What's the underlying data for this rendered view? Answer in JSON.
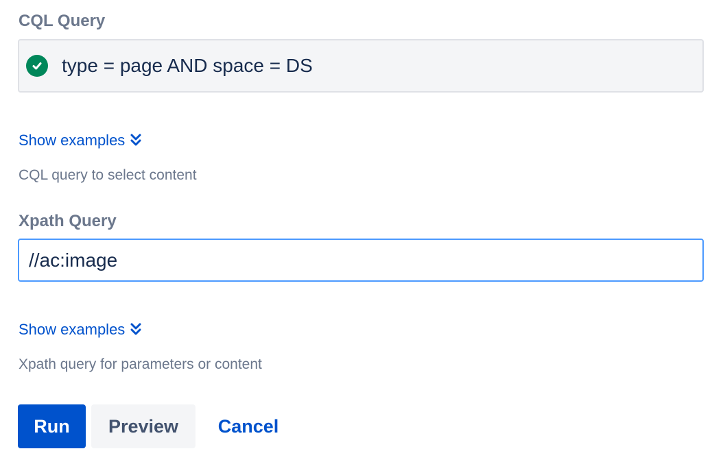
{
  "cql": {
    "label": "CQL Query",
    "value": "type = page AND space = DS",
    "status_icon": "check-circle-icon",
    "status_color": "#00875a",
    "show_examples": "Show examples",
    "helper": "CQL query to select content"
  },
  "xpath": {
    "label": "Xpath Query",
    "value": "//ac:image",
    "show_examples": "Show examples",
    "helper": "Xpath query for parameters or content"
  },
  "actions": {
    "run": "Run",
    "preview": "Preview",
    "cancel": "Cancel"
  },
  "colors": {
    "primary": "#0052cc",
    "focus_border": "#4c9aff",
    "label": "#6b778c",
    "text": "#172b4d"
  }
}
